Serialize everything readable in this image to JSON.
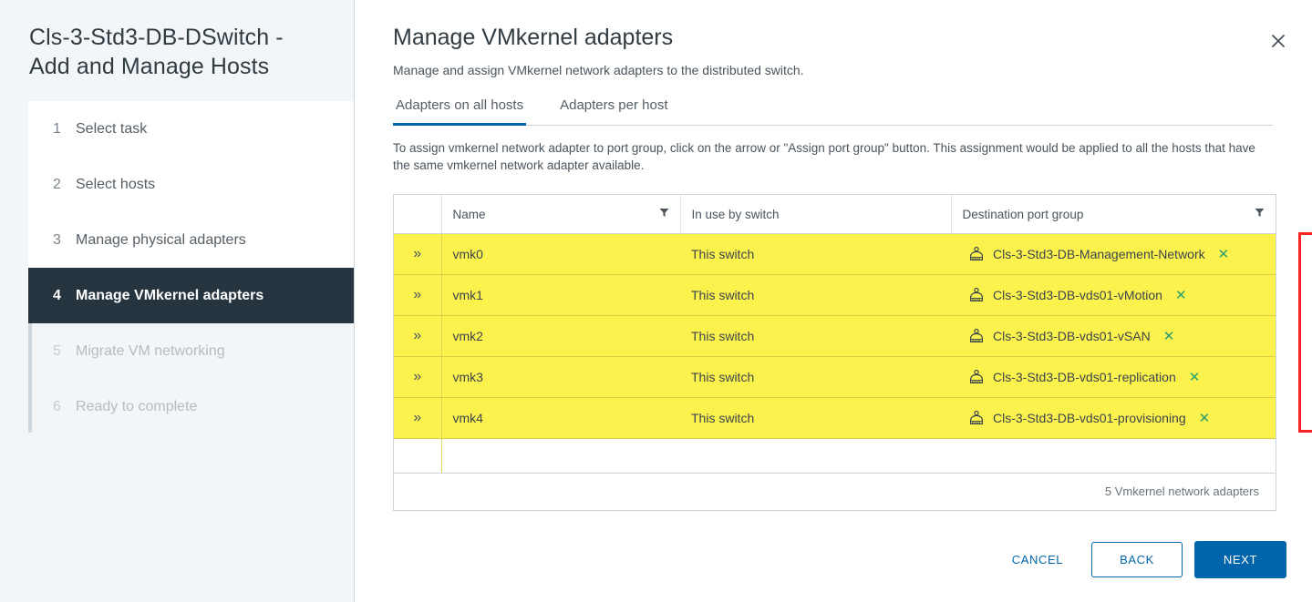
{
  "sidebar": {
    "title": "Cls-3-Std3-DB-DSwitch - Add and Manage Hosts",
    "steps": [
      {
        "num": "1",
        "label": "Select task",
        "state": "done"
      },
      {
        "num": "2",
        "label": "Select hosts",
        "state": "done"
      },
      {
        "num": "3",
        "label": "Manage physical adapters",
        "state": "done"
      },
      {
        "num": "4",
        "label": "Manage VMkernel adapters",
        "state": "active"
      },
      {
        "num": "5",
        "label": "Migrate VM networking",
        "state": "disabled"
      },
      {
        "num": "6",
        "label": "Ready to complete",
        "state": "disabled"
      }
    ]
  },
  "main": {
    "title": "Manage VMkernel adapters",
    "subtitle": "Manage and assign VMkernel network adapters to the distributed switch.",
    "close_label": "✕",
    "tabs": [
      {
        "label": "Adapters on all hosts",
        "selected": true
      },
      {
        "label": "Adapters per host",
        "selected": false
      }
    ],
    "instructions": "To assign vmkernel network adapter to port group, click on the arrow or \"Assign port group\" button. This assignment would be applied to all the hosts that have the same vmkernel network adapter available.",
    "table": {
      "columns": [
        "",
        "Name",
        "In use by switch",
        "Destination port group"
      ],
      "arrow_glyph": "»",
      "filter_glyph": "▼",
      "remove_glyph": "✕",
      "rows": [
        {
          "name": "vmk0",
          "in_use": "This switch",
          "dest": "Cls-3-Std3-DB-Management-Network"
        },
        {
          "name": "vmk1",
          "in_use": "This switch",
          "dest": "Cls-3-Std3-DB-vds01-vMotion"
        },
        {
          "name": "vmk2",
          "in_use": "This switch",
          "dest": "Cls-3-Std3-DB-vds01-vSAN"
        },
        {
          "name": "vmk3",
          "in_use": "This switch",
          "dest": "Cls-3-Std3-DB-vds01-replication"
        },
        {
          "name": "vmk4",
          "in_use": "This switch",
          "dest": "Cls-3-Std3-DB-vds01-provisioning"
        }
      ],
      "footer_count": "5 Vmkernel network adapters"
    }
  },
  "footer": {
    "cancel": "CANCEL",
    "back": "BACK",
    "next": "NEXT"
  },
  "colors": {
    "accent_blue": "#0065ab",
    "progress_green": "#318700",
    "highlight_yellow": "#fcf24e",
    "annotation_red": "#fb2323",
    "remove_green": "#2e9e6b",
    "active_step_bg": "#263440"
  }
}
